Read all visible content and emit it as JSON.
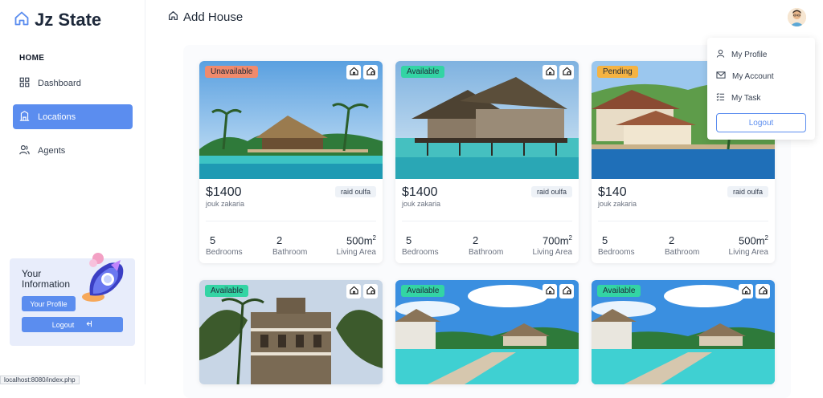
{
  "brand": {
    "title": "Jz State"
  },
  "sidebar": {
    "heading": "HOME",
    "items": [
      {
        "label": "Dashboard",
        "icon": "grid-icon"
      },
      {
        "label": "Locations",
        "icon": "building-icon",
        "active": true
      },
      {
        "label": "Agents",
        "icon": "users-icon"
      }
    ],
    "info_card": {
      "title": "Your Information",
      "profile_button": "Your Profile",
      "logout_button": "Logout"
    }
  },
  "topbar": {
    "title": "Add House"
  },
  "dropdown": {
    "items": [
      {
        "label": "My Profile",
        "icon": "user-icon"
      },
      {
        "label": "My Account",
        "icon": "mail-icon"
      },
      {
        "label": "My Task",
        "icon": "list-icon"
      }
    ],
    "logout": "Logout"
  },
  "colors": {
    "accent": "#5b8def",
    "unavailable": "#f08a6c",
    "available": "#33d4a4",
    "pending": "#f5b342"
  },
  "cards": [
    {
      "status": "Unavailable",
      "price": "$1400",
      "owner": "jouk zakaria",
      "agent": "raid oulfa",
      "bedrooms": "5",
      "bedrooms_label": "Bedrooms",
      "bathroom": "2",
      "bathroom_label": "Bathroom",
      "area": "500m",
      "area_sup": "2",
      "area_label": "Living Area"
    },
    {
      "status": "Available",
      "price": "$1400",
      "owner": "jouk zakaria",
      "agent": "raid oulfa",
      "bedrooms": "5",
      "bedrooms_label": "Bedrooms",
      "bathroom": "2",
      "bathroom_label": "Bathroom",
      "area": "700m",
      "area_sup": "2",
      "area_label": "Living Area"
    },
    {
      "status": "Pending",
      "price": "$140",
      "owner": "jouk zakaria",
      "agent": "raid oulfa",
      "bedrooms": "5",
      "bedrooms_label": "Bedrooms",
      "bathroom": "2",
      "bathroom_label": "Bathroom",
      "area": "500m",
      "area_sup": "2",
      "area_label": "Living Area"
    },
    {
      "status": "Available"
    },
    {
      "status": "Available"
    },
    {
      "status": "Available"
    }
  ],
  "status_bar": {
    "url": "localhost:8080/index.php"
  }
}
